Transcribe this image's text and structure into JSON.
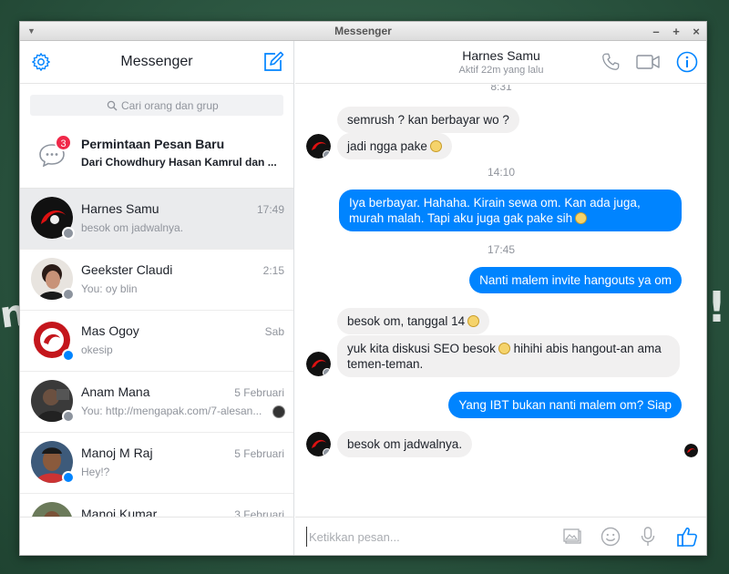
{
  "window": {
    "title": "Messenger"
  },
  "sidebar": {
    "title": "Messenger",
    "search_placeholder": "Cari orang dan grup",
    "message_request": {
      "count": "3",
      "title": "Permintaan Pesan Baru",
      "subtitle": "Dari Chowdhury Hasan Kamrul dan ..."
    },
    "conversations": [
      {
        "name": "Harnes Samu",
        "preview": "besok om jadwalnya.",
        "time": "17:49",
        "platform": "facebook",
        "active": true
      },
      {
        "name": "Geekster Claudi",
        "preview": "You: oy blin",
        "time": "2:15",
        "platform": "facebook"
      },
      {
        "name": "Mas Ogoy",
        "preview": "okesip",
        "time": "Sab",
        "platform": "messenger"
      },
      {
        "name": "Anam Mana",
        "preview": "You: http://mengapak.com/7-alesan...",
        "time": "5 Februari",
        "platform": "facebook"
      },
      {
        "name": "Manoj M Raj",
        "preview": "Hey!?",
        "time": "5 Februari",
        "platform": "messenger"
      },
      {
        "name": "Manoj Kumar",
        "preview": "",
        "time": "3 Februari",
        "platform": "facebook"
      }
    ]
  },
  "chat": {
    "contact_name": "Harnes Samu",
    "status": "Aktif 22m yang lalu",
    "timestamps": [
      "8:31",
      "14:10",
      "17:45"
    ],
    "messages": [
      {
        "direction": "in",
        "text": "semrush ? kan berbayar wo ?"
      },
      {
        "direction": "in",
        "text": "jadi ngga pake"
      },
      {
        "direction": "out",
        "text": "Iya berbayar. Hahaha. Kirain sewa om. Kan ada juga, murah malah. Tapi aku juga gak pake sih"
      },
      {
        "direction": "out",
        "text": "Nanti malem invite hangouts ya om"
      },
      {
        "direction": "in",
        "text": "besok om, tanggal 14"
      },
      {
        "direction": "in",
        "text": "yuk kita diskusi SEO besok",
        "text2": "hihihi abis hangout-an ama temen-teman."
      },
      {
        "direction": "out",
        "text": "Yang IBT bukan nanti malem om? Siap"
      },
      {
        "direction": "in",
        "text": "besok om jadwalnya."
      }
    ],
    "composer_placeholder": "Ketikkan pesan..."
  },
  "colors": {
    "accent": "#0084ff",
    "badge": "#f02849"
  }
}
